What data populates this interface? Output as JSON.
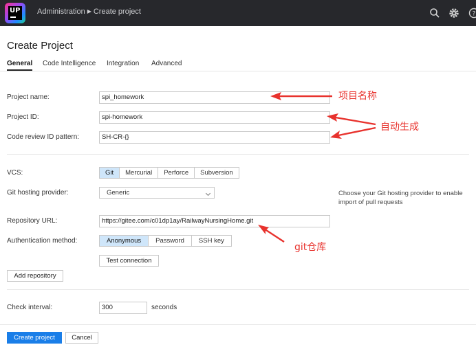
{
  "header": {
    "logo_text": "UP",
    "breadcrumb": [
      "Administration",
      "Create project"
    ],
    "icons": [
      "search-icon",
      "gear-icon",
      "help-icon"
    ]
  },
  "page": {
    "title": "Create Project",
    "tabs": [
      {
        "label": "General",
        "active": true
      },
      {
        "label": "Code Intelligence",
        "active": false
      },
      {
        "label": "Integration",
        "active": false
      },
      {
        "label": "Advanced",
        "active": false
      }
    ]
  },
  "form": {
    "project_name": {
      "label": "Project name:",
      "value": "spi_homework"
    },
    "project_id": {
      "label": "Project ID:",
      "value": "spi-homework"
    },
    "code_review": {
      "label": "Code review ID pattern:",
      "value": "SH-CR-{}"
    },
    "vcs": {
      "label": "VCS:",
      "options": [
        "Git",
        "Mercurial",
        "Perforce",
        "Subversion"
      ],
      "selected": "Git"
    },
    "hosting": {
      "label": "Git hosting provider:",
      "value": "Generic",
      "hint": "Choose your Git hosting provider to enable import of pull requests"
    },
    "repo_url": {
      "label": "Repository URL:",
      "value": "https://gitee.com/c01dp1ay/RailwayNursingHome.git"
    },
    "auth": {
      "label": "Authentication method:",
      "options": [
        "Anonymous",
        "Password",
        "SSH key"
      ],
      "selected": "Anonymous"
    },
    "test_connection": "Test connection",
    "add_repository": "Add repository",
    "check_interval": {
      "label": "Check interval:",
      "value": "300",
      "unit": "seconds"
    }
  },
  "actions": {
    "create": "Create project",
    "cancel": "Cancel"
  },
  "annotations": {
    "project_name_note": "项目名称",
    "auto_generated_note": "自动生成",
    "git_repo_note": "git仓库"
  },
  "colors": {
    "topbar": "#27282c",
    "primary": "#1a7ee8",
    "selected": "#cfe6fa",
    "annotation": "#e8322d"
  }
}
